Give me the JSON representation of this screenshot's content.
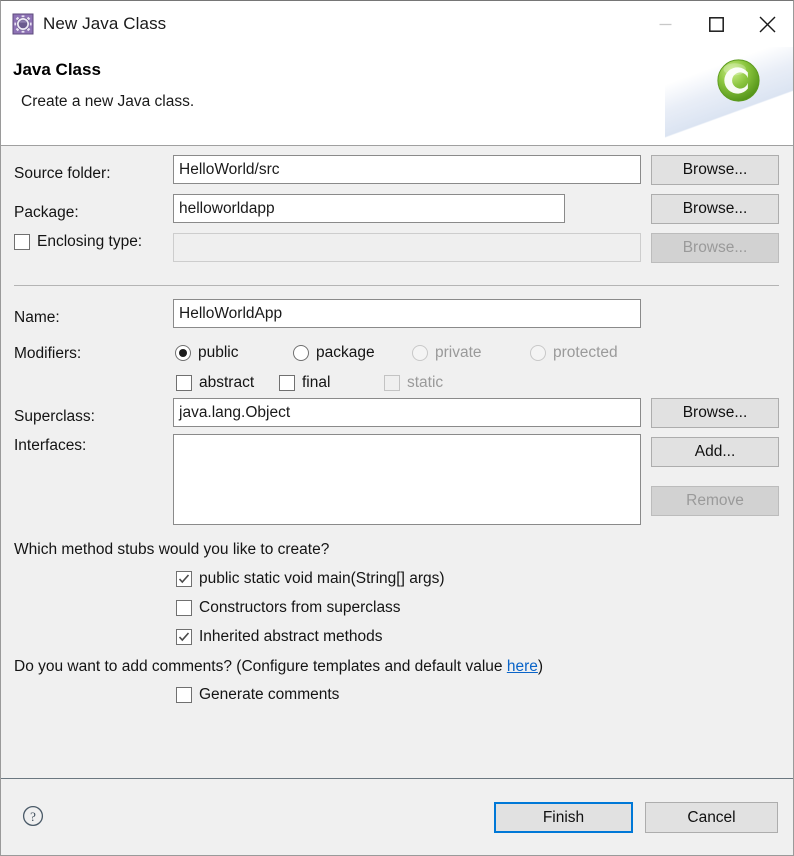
{
  "window": {
    "title": "New Java Class",
    "icon": "java-class-wizard-icon",
    "controls": {
      "minimize": "—",
      "maximize": "□",
      "close": "✕"
    }
  },
  "header": {
    "title": "Java Class",
    "description": "Create a new Java class.",
    "logo": "eclipse-c-logo"
  },
  "form": {
    "source_folder": {
      "label": "Source folder:",
      "value": "HelloWorld/src",
      "browse_label": "Browse..."
    },
    "package": {
      "label": "Package:",
      "value": "helloworldapp",
      "browse_label": "Browse..."
    },
    "enclosing_type": {
      "label": "Enclosing type:",
      "value": "",
      "checked": false,
      "browse_label": "Browse...",
      "disabled": true
    },
    "name": {
      "label": "Name:",
      "value": "HelloWorldApp"
    },
    "modifiers": {
      "label": "Modifiers:",
      "radios": [
        {
          "label": "public",
          "selected": true,
          "disabled": false
        },
        {
          "label": "package",
          "selected": false,
          "disabled": false
        },
        {
          "label": "private",
          "selected": false,
          "disabled": true
        },
        {
          "label": "protected",
          "selected": false,
          "disabled": true
        }
      ],
      "checkboxes": [
        {
          "label": "abstract",
          "checked": false,
          "disabled": false
        },
        {
          "label": "final",
          "checked": false,
          "disabled": false
        },
        {
          "label": "static",
          "checked": false,
          "disabled": true
        }
      ]
    },
    "superclass": {
      "label": "Superclass:",
      "value": "java.lang.Object",
      "browse_label": "Browse..."
    },
    "interfaces": {
      "label": "Interfaces:",
      "value": "",
      "add_label": "Add...",
      "remove_label": "Remove",
      "remove_disabled": true
    }
  },
  "stubs": {
    "question": "Which method stubs would you like to create?",
    "options": [
      {
        "label": "public static void main(String[] args)",
        "checked": true
      },
      {
        "label": "Constructors from superclass",
        "checked": false
      },
      {
        "label": "Inherited abstract methods",
        "checked": true
      }
    ]
  },
  "comments": {
    "question_prefix": "Do you want to add comments? (Configure templates and default value ",
    "link": "here",
    "question_suffix": ")",
    "option": {
      "label": "Generate comments",
      "checked": false
    }
  },
  "footer": {
    "help": "?",
    "finish_label": "Finish",
    "cancel_label": "Cancel"
  },
  "colors": {
    "accent": "#0078d7",
    "link": "#0a64c8",
    "dialog_bg": "#f0f0f0"
  }
}
